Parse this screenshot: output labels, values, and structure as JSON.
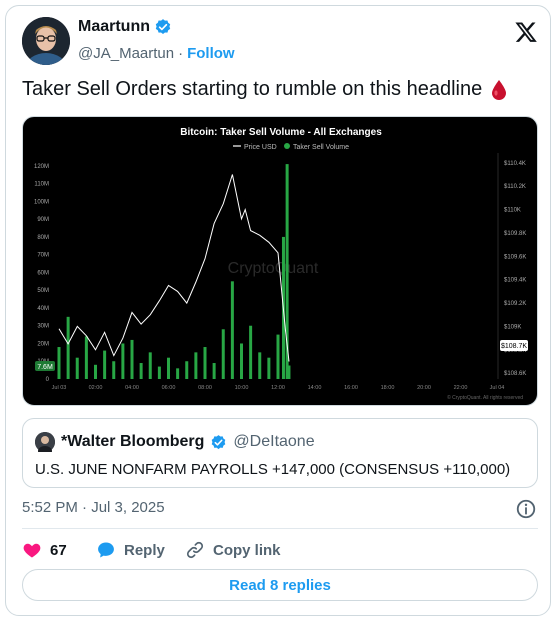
{
  "author": {
    "name": "Maartunn",
    "handle": "@JA_Maartun",
    "separator": "·",
    "follow_label": "Follow"
  },
  "tweet": {
    "text": "Taker Sell Orders starting to rumble on this headline",
    "emoji": "drop-of-blood"
  },
  "media": {
    "chart_data": {
      "type": "line",
      "title": "Bitcoin: Taker Sell Volume - All Exchanges",
      "legend": [
        "Price USD",
        "Taker Sell Volume"
      ],
      "legend_position": "top-center",
      "watermark": "CryptoQuant",
      "footer": "© CryptoQuant. All rights reserved",
      "left_axis": {
        "ticks": [
          "0",
          "10M",
          "20M",
          "30M",
          "40M",
          "50M",
          "60M",
          "70M",
          "80M",
          "90M",
          "100M",
          "110M",
          "120M"
        ],
        "range": [
          0,
          125
        ]
      },
      "right_axis": {
        "ticks": [
          "$108.6K",
          "$108.8K",
          "$109K",
          "$109.2K",
          "$109.4K",
          "$109.6K",
          "$109.8K",
          "$110K",
          "$110.2K",
          "$110.4K"
        ],
        "range": [
          108.55,
          110.45
        ]
      },
      "x_ticks": [
        "Jul 03",
        "02:00",
        "04:00",
        "06:00",
        "08:00",
        "10:00",
        "12:00",
        "14:00",
        "16:00",
        "18:00",
        "20:00",
        "22:00",
        "Jul 04"
      ],
      "last_volume_label": "7.6M",
      "last_price_label": "$108.7K",
      "colors": {
        "price": "#ffffff",
        "volume": "#28a745",
        "label_bg": "#1e7a34",
        "background": "#000000"
      },
      "series": [
        {
          "name": "Price USD",
          "x": [
            0,
            0.5,
            1,
            1.5,
            2,
            2.5,
            3,
            3.5,
            4,
            4.5,
            5,
            5.5,
            6,
            6.5,
            7,
            7.5,
            8,
            8.5,
            9,
            9.5,
            10,
            10.2,
            10.5,
            11,
            11.5,
            12,
            12.4,
            12.6
          ],
          "values": [
            108.98,
            108.85,
            109.0,
            108.92,
            108.8,
            108.95,
            108.75,
            108.9,
            109.12,
            109.02,
            109.1,
            109.22,
            109.35,
            109.3,
            109.2,
            109.38,
            109.58,
            109.88,
            110.05,
            110.3,
            109.92,
            110.0,
            109.82,
            109.78,
            109.72,
            109.63,
            108.98,
            108.7
          ]
        },
        {
          "name": "Taker Sell Volume",
          "x": [
            0,
            0.5,
            1,
            1.5,
            2,
            2.5,
            3,
            3.5,
            4,
            4.5,
            5,
            5.5,
            6,
            6.5,
            7,
            7.5,
            8,
            8.5,
            9,
            9.5,
            10,
            10.5,
            11,
            11.5,
            12,
            12.3,
            12.5,
            12.6
          ],
          "values": [
            18,
            35,
            12,
            24,
            8,
            16,
            10,
            20,
            22,
            9,
            15,
            7,
            12,
            6,
            10,
            15,
            18,
            9,
            28,
            55,
            20,
            30,
            15,
            12,
            25,
            80,
            121,
            7.6
          ]
        }
      ]
    }
  },
  "quote": {
    "name": "*Walter Bloomberg",
    "handle": "@DeItaone",
    "text": "U.S. JUNE NONFARM PAYROLLS +147,000 (CONSENSUS +110,000)"
  },
  "timestamp": "5:52 PM · Jul 3, 2025",
  "actions": {
    "likes": "67",
    "reply_label": "Reply",
    "copy_link_label": "Copy link"
  },
  "read_replies_label": "Read 8 replies",
  "colors": {
    "accent": "#1d9bf0",
    "like": "#f91880",
    "verified": "#1d9bf0",
    "muted": "#536471"
  }
}
